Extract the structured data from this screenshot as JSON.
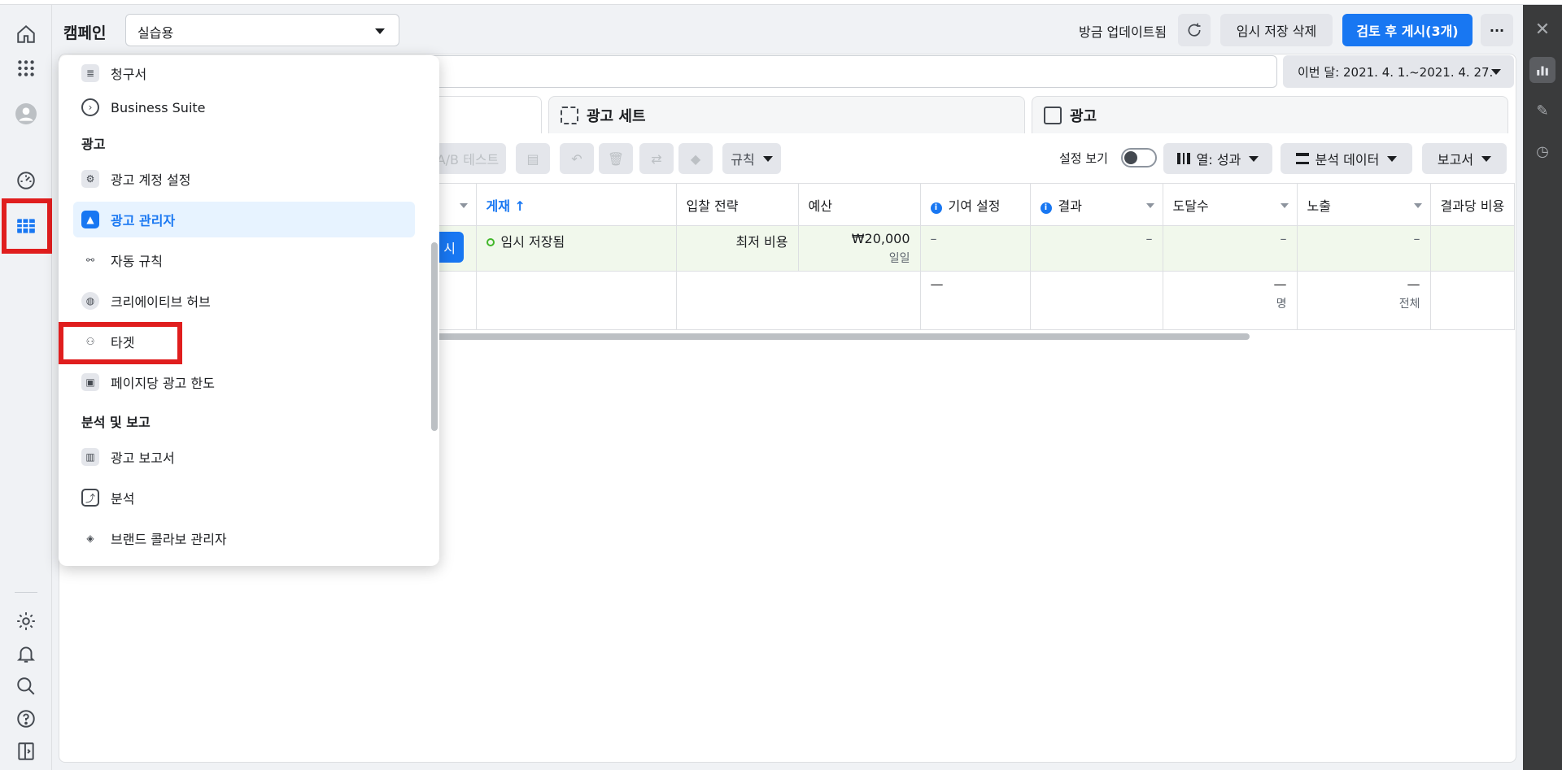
{
  "leftnav": {
    "items": [
      {
        "icon": "home-icon"
      },
      {
        "icon": "apps-grid-icon"
      },
      {
        "icon": "avatar"
      },
      {
        "icon": "dashboard-gauge-icon"
      },
      {
        "icon": "ads-manager-table-icon"
      },
      {
        "icon": "settings-gear-icon"
      },
      {
        "icon": "bell-icon"
      },
      {
        "icon": "search-icon"
      },
      {
        "icon": "help-icon"
      },
      {
        "icon": "sidebar-toggle-icon"
      }
    ]
  },
  "topbar": {
    "campaign_label": "캠페인",
    "campaign_select_value": "실습용",
    "updated_text": "방금 업데이트됨",
    "discard_drafts": "임시 저장 삭제",
    "review_publish": "검토 후 게시(3개)",
    "more": "···"
  },
  "filters": {
    "date_range": "이번 달: 2021. 4. 1.~2021. 4. 27."
  },
  "tabs": [
    {
      "label": "광고 세트"
    },
    {
      "label": "광고"
    }
  ],
  "toolbar": {
    "ab_test": "A/B 테스트",
    "rules": "규칙",
    "view_setup": "설정 보기",
    "columns": "열: 성과",
    "breakdown": "분석 데이터",
    "reports": "보고서"
  },
  "table": {
    "columns": [
      "게재 ↑",
      "입찰 전략",
      "예산",
      "기여 설정",
      "결과",
      "도달수",
      "노출",
      "결과당 비용"
    ],
    "row1": {
      "delivery": "임시 저장됨",
      "bid": "최저 비용",
      "budget": "₩20,000",
      "budget_sub": "일일",
      "attribution": "–",
      "results": "–",
      "reach": "–",
      "impressions": "–"
    },
    "row2": {
      "attribution": "—",
      "reach": "—",
      "reach_sub": "명",
      "impressions": "—",
      "impressions_sub": "전체"
    },
    "publish_chip": "시"
  },
  "menu": {
    "items_top": [
      {
        "label": "청구서",
        "icon": "invoice-icon"
      },
      {
        "label": "Business Suite",
        "icon": "business-suite-icon"
      }
    ],
    "section_ads": "광고",
    "items_ads": [
      {
        "label": "광고 계정 설정",
        "icon": "account-settings-icon"
      },
      {
        "label": "광고 관리자",
        "icon": "ads-manager-icon"
      },
      {
        "label": "자동 규칙",
        "icon": "rules-icon"
      },
      {
        "label": "크리에이티브 허브",
        "icon": "palette-icon"
      },
      {
        "label": "타겟",
        "icon": "audience-icon"
      },
      {
        "label": "페이지당 광고 한도",
        "icon": "page-limit-icon"
      }
    ],
    "section_analytics": "분석 및 보고",
    "items_analytics": [
      {
        "label": "광고 보고서",
        "icon": "report-icon"
      },
      {
        "label": "분석",
        "icon": "analytics-icon"
      },
      {
        "label": "브랜드 콜라보 관리자",
        "icon": "handshake-icon"
      }
    ]
  },
  "rightbar": {
    "items": [
      {
        "icon": "close-icon"
      },
      {
        "icon": "chart-icon"
      },
      {
        "icon": "edit-pencil-icon"
      },
      {
        "icon": "history-clock-icon"
      }
    ]
  }
}
